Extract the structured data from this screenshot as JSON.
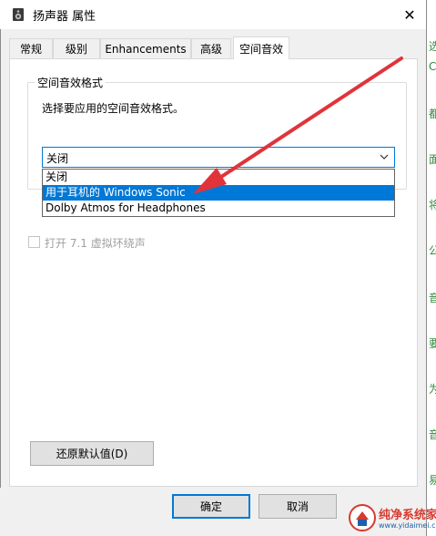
{
  "window": {
    "title": "扬声器 属性",
    "close_glyph": "✕"
  },
  "tabs": [
    {
      "label": "常规",
      "active": false
    },
    {
      "label": "级别",
      "active": false
    },
    {
      "label": "Enhancements",
      "active": false
    },
    {
      "label": "高级",
      "active": false
    },
    {
      "label": "空间音效",
      "active": true
    }
  ],
  "spatial": {
    "group_title": "空间音效格式",
    "description": "选择要应用的空间音效格式。",
    "selected": "关闭",
    "options": [
      "关闭",
      "用于耳机的 Windows Sonic",
      "Dolby Atmos for Headphones"
    ],
    "highlighted_index": 1
  },
  "virtual_surround": {
    "label": "打开 7.1 虚拟环绕声",
    "checked": false,
    "enabled": false
  },
  "buttons": {
    "restore_defaults": "还原默认值(D)",
    "ok": "确定",
    "cancel": "取消"
  },
  "background_window": {
    "chars": [
      "选",
      "C",
      "都",
      "面",
      "将",
      "公",
      "音",
      "要",
      "为",
      "音",
      "易"
    ]
  },
  "watermark": {
    "name": "纯净系统家园",
    "url": "www.yidaimei.com"
  },
  "colors": {
    "accent": "#0078d7",
    "annotation_arrow": "#e0343a"
  }
}
